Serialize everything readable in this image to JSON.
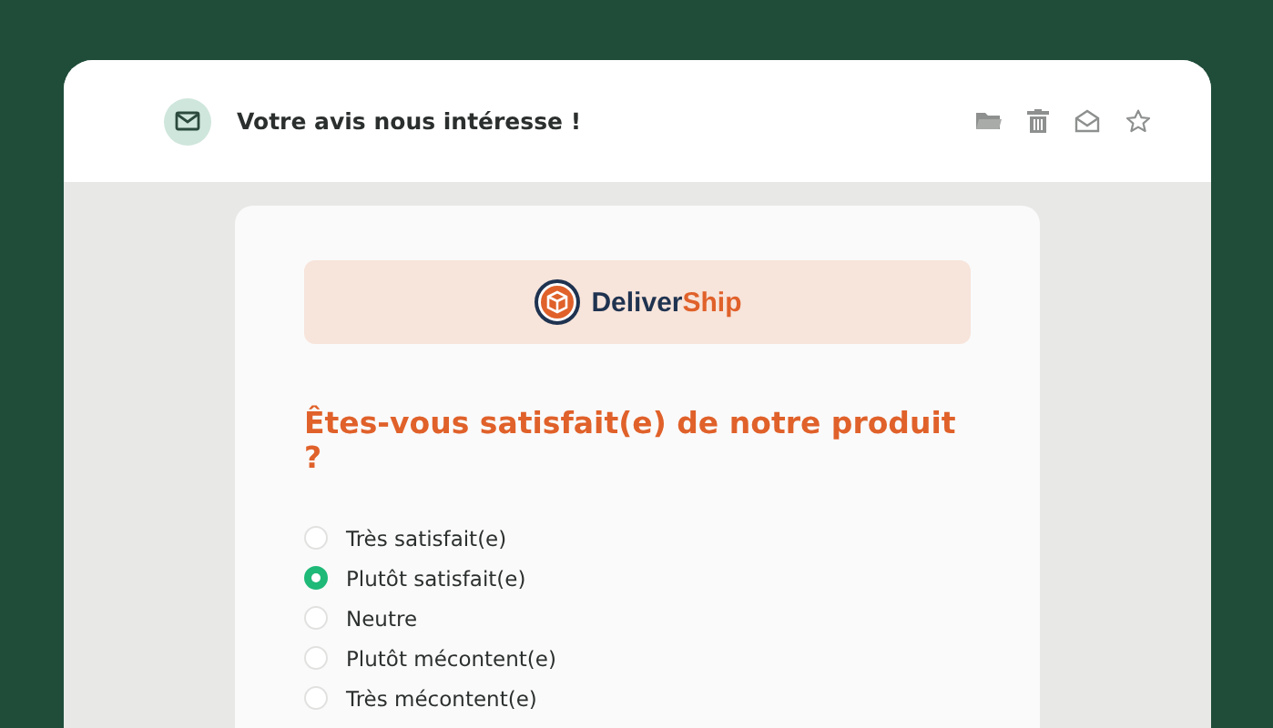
{
  "email": {
    "subject": "Votre avis nous intéresse !"
  },
  "brand": {
    "part_1": "Deliver",
    "part_2": "Ship"
  },
  "question": "Êtes-vous satisfait(e) de notre produit ?",
  "options": [
    {
      "label": "Très satisfait(e)",
      "selected": false
    },
    {
      "label": "Plutôt satisfait(e)",
      "selected": true
    },
    {
      "label": "Neutre",
      "selected": false
    },
    {
      "label": "Plutôt mécontent(e)",
      "selected": false
    },
    {
      "label": "Très mécontent(e)",
      "selected": false
    }
  ]
}
